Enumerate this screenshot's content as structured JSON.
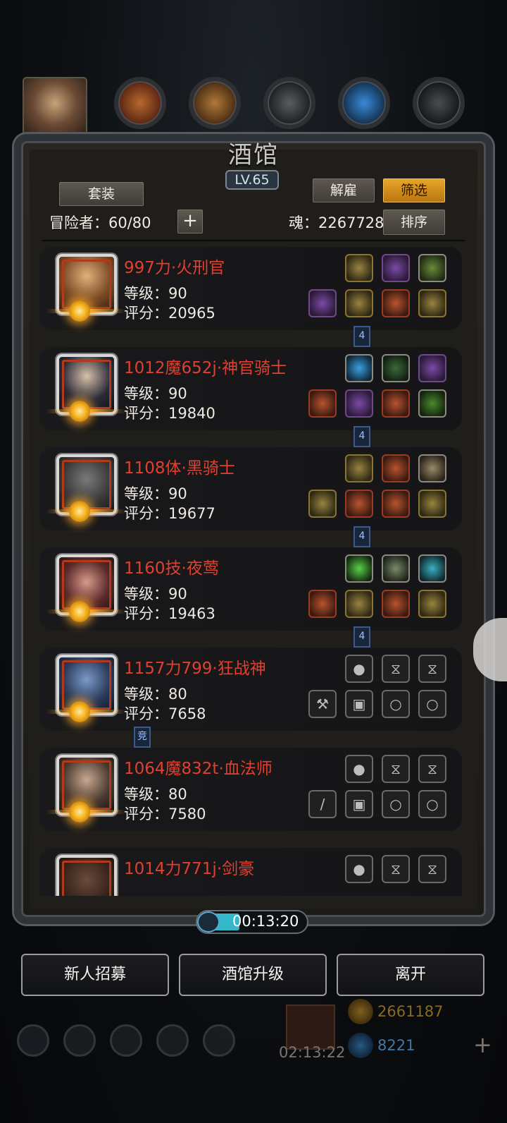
{
  "title": "酒馆",
  "level": "LV.65",
  "buttons": {
    "set": "套装",
    "dismiss": "解雇",
    "filter": "筛选",
    "sort": "排序",
    "plus": "+"
  },
  "adventurers": "冒险者：60/80",
  "soul": "魂：2267728",
  "heroes": [
    {
      "name": "997力·火刑官",
      "level": "等级：90",
      "score": "评分：20965",
      "chain": "4"
    },
    {
      "name": "1012魔652j·神官骑士",
      "level": "等级：90",
      "score": "评分：19840",
      "chain": "4"
    },
    {
      "name": "1108体·黑骑士",
      "level": "等级：90",
      "score": "评分：19677",
      "chain": "4"
    },
    {
      "name": "1160技·夜莺",
      "level": "等级：90",
      "score": "评分：19463",
      "chain": "4"
    },
    {
      "name": "1157力799·狂战神",
      "level": "等级：80",
      "score": "评分：7658",
      "chain": "竞"
    },
    {
      "name": "1064魔832t·血法师",
      "level": "等级：80",
      "score": "评分：7580",
      "chain": ""
    },
    {
      "name": "1014力771j·剑豪",
      "level": "",
      "score": "",
      "chain": ""
    }
  ],
  "timer": "00:13:20",
  "bottom_buttons": {
    "recruit": "新人招募",
    "upgrade": "酒馆升级",
    "leave": "离开"
  },
  "hud": {
    "gift_timer": "02:13:22",
    "gold": "2661187",
    "gems": "8221"
  }
}
